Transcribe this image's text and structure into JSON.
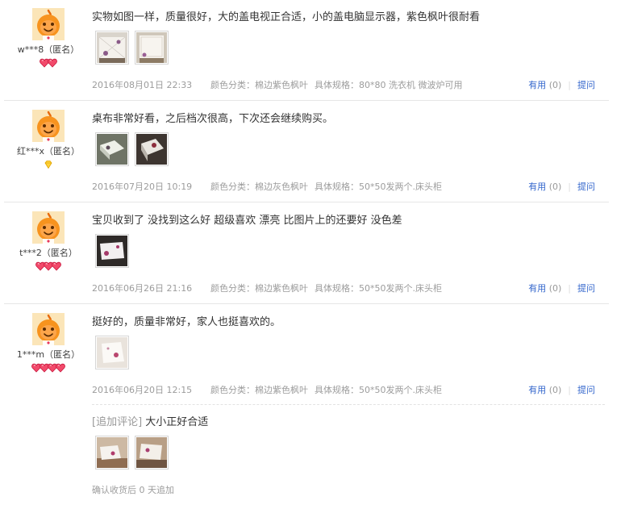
{
  "colors": {
    "link": "#3366cc",
    "meta_text": "#9c9c9c",
    "body_text": "#333333",
    "divider": "#e6e6e6",
    "avatar_orange": "#f39c12"
  },
  "reviews": [
    {
      "user": "w***8（匿名）",
      "level_icon": "red-heart",
      "level_count": 2,
      "text": "实物如图一样，质量很好，大的盖电视正合适，小的盖电脑显示器，紫色枫叶很耐看",
      "photos": [
        "photo-tablecloth-on-tv",
        "photo-tablecloth-on-monitor"
      ],
      "date": "2016年08月01日 22:33",
      "color": "颜色分类：棉边紫色枫叶",
      "spec": "具体规格：80*80 洗衣机 微波炉可用",
      "useful_label": "有用",
      "useful_count": "(0)",
      "ask_label": "提问"
    },
    {
      "user": "红***x（匿名）",
      "level_icon": "yellow-diamond",
      "level_count": 1,
      "text": "桌布非常好看，之后档次很高，下次还会继续购买。",
      "photos": [
        "photo-tablecloth-nightstand",
        "photo-tablecloth-nightstand-2"
      ],
      "date": "2016年07月20日 10:19",
      "color": "颜色分类：棉边灰色枫叶",
      "spec": "具体规格：50*50发两个.床头柜",
      "useful_label": "有用",
      "useful_count": "(0)",
      "ask_label": "提问"
    },
    {
      "user": "t***2（匿名）",
      "level_icon": "red-heart",
      "level_count": 3,
      "text": "宝贝收到了 没找到这么好 超级喜欢 漂亮 比图片上的还要好 没色差",
      "photos": [
        "photo-tablecloth-table"
      ],
      "date": "2016年06月26日 21:16",
      "color": "颜色分类：棉边紫色枫叶",
      "spec": "具体规格：50*50发两个.床头柜",
      "useful_label": "有用",
      "useful_count": "(0)",
      "ask_label": "提问"
    },
    {
      "user": "1***m（匿名）",
      "level_icon": "red-heart",
      "level_count": 4,
      "text": "挺好的，质量非常好，家人也挺喜欢的。",
      "photos": [
        "photo-tablecloth-white"
      ],
      "date": "2016年06月20日 12:15",
      "color": "颜色分类：棉边紫色枫叶",
      "spec": "具体规格：50*50发两个.床头柜",
      "useful_label": "有用",
      "useful_count": "(0)",
      "ask_label": "提问",
      "append": {
        "tag": "[追加评论]",
        "text": "大小正好合适",
        "photos": [
          "photo-append-room",
          "photo-append-table"
        ],
        "days": "确认收货后 0 天追加"
      }
    }
  ]
}
